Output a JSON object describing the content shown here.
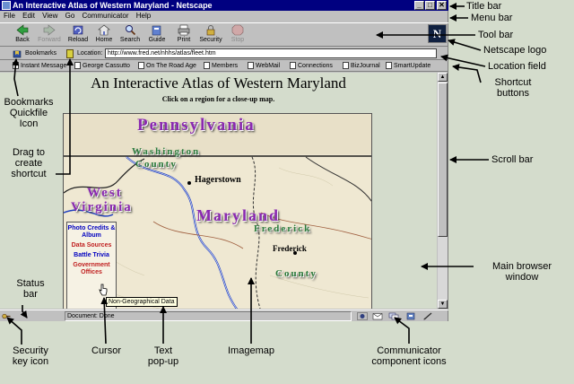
{
  "window": {
    "title": "An Interactive Atlas of Western Maryland - Netscape",
    "minimize_glyph": "_",
    "maximize_glyph": "□",
    "close_glyph": "✕"
  },
  "menu": {
    "items": [
      "File",
      "Edit",
      "View",
      "Go",
      "Communicator",
      "Help"
    ]
  },
  "toolbar": {
    "buttons": [
      {
        "label": "Back",
        "icon": "back-arrow-icon"
      },
      {
        "label": "Forward",
        "icon": "forward-arrow-icon"
      },
      {
        "label": "Reload",
        "icon": "reload-icon"
      },
      {
        "label": "Home",
        "icon": "home-icon"
      },
      {
        "label": "Search",
        "icon": "search-icon"
      },
      {
        "label": "Guide",
        "icon": "guide-icon"
      },
      {
        "label": "Print",
        "icon": "print-icon"
      },
      {
        "label": "Security",
        "icon": "security-icon"
      },
      {
        "label": "Stop",
        "icon": "stop-icon"
      }
    ],
    "logo_letter": "N"
  },
  "location": {
    "bookmarks_label": "Bookmarks",
    "location_label": "Location:",
    "url": "http://www.fred.net/nhhs/atlas/fleet.htm"
  },
  "personal_toolbar": {
    "items": [
      "Instant Message",
      "George Cassutto",
      "On The Road Age",
      "Members",
      "WebMail",
      "Connections",
      "BizJournal",
      "SmartUpdate"
    ]
  },
  "page": {
    "title": "An Interactive Atlas of Western Maryland",
    "subtitle": "Click on a region for a close-up map.",
    "map": {
      "regions": [
        {
          "text": "Pennsylvania",
          "color": "#8a2ab0"
        },
        {
          "text": "Washington",
          "color": "#2a7a3a"
        },
        {
          "text": "County",
          "color": "#2a7a3a"
        },
        {
          "text": "Hagerstown",
          "color": "#000000"
        },
        {
          "text": "West",
          "color": "#8a2ab0"
        },
        {
          "text": "Virginia",
          "color": "#8a2ab0"
        },
        {
          "text": "Maryland",
          "color": "#8a2ab0"
        },
        {
          "text": "Frederick",
          "color": "#2a7a3a"
        },
        {
          "text": "Frederick",
          "color": "#000000"
        },
        {
          "text": "County",
          "color": "#2a7a3a"
        }
      ]
    },
    "side_links": [
      "Photo Credits & Album",
      "Data Sources",
      "Battle Trivia",
      "Government Offices"
    ],
    "tooltip": "Non-Geographical Data"
  },
  "status": {
    "text": "Document: Done"
  },
  "annotations": {
    "title_bar": "Title bar",
    "menu_bar": "Menu bar",
    "tool_bar": "Tool bar",
    "netscape_logo": "Netscape logo",
    "location_field": "Location field",
    "shortcut_buttons_1": "Shortcut",
    "shortcut_buttons_2": "buttons",
    "bookmarks_1": "Bookmarks",
    "bookmarks_2": "Quickfile",
    "bookmarks_3": "Icon",
    "drag_1": "Drag to",
    "drag_2": "create",
    "drag_3": "shortcut",
    "scroll_bar": "Scroll bar",
    "main_window_1": "Main browser",
    "main_window_2": "window",
    "status_bar_1": "Status",
    "status_bar_2": "bar",
    "security_1": "Security",
    "security_2": "key icon",
    "cursor": "Cursor",
    "text_popup_1": "Text",
    "text_popup_2": "pop-up",
    "imagemap": "Imagemap",
    "communicator_1": "Communicator",
    "communicator_2": "component icons"
  },
  "colors": {
    "titlebar": "#000080",
    "background": "#d4dccc",
    "link_blue": "#0000c0",
    "link_red": "#c02020"
  }
}
